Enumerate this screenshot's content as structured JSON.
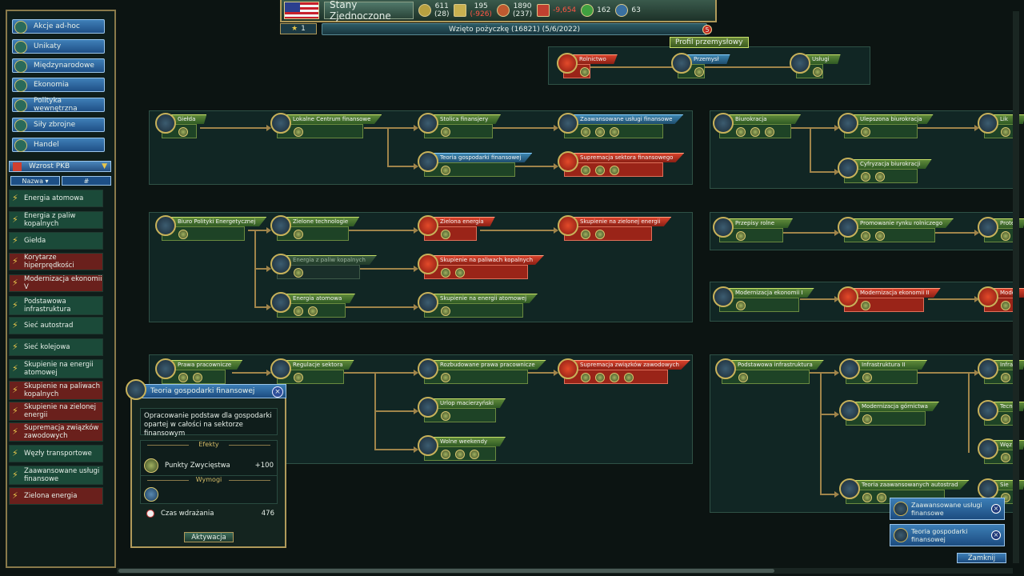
{
  "topbar": {
    "country": "Stany Zjednoczone",
    "res1": {
      "top": "611",
      "bottom": "(28)"
    },
    "res2": {
      "top": "195",
      "bottom": "(-926)"
    },
    "res3": {
      "top": "1890",
      "bottom": "(237)"
    },
    "res4": "-9,654",
    "res5": "162",
    "res6": "63",
    "turn": "1",
    "news": "Wzięto pożyczkę (16821) (5/6/2022)",
    "news_count": "5"
  },
  "sidebar": {
    "categories": [
      "Akcje ad-hoc",
      "Unikaty",
      "Międzynarodowe",
      "Ekonomia",
      "Polityka wewnętrzna",
      "Siły zbrojne",
      "Handel"
    ],
    "dropdown": "Wzrost PKB",
    "sort_name": "Nazwa",
    "sort_num": "#",
    "items": [
      {
        "label": "Energia atomowa",
        "color": "green"
      },
      {
        "label": "Energia z paliw kopalnych",
        "color": "green"
      },
      {
        "label": "Giełda",
        "color": "green"
      },
      {
        "label": "Korytarze hiperprędkości",
        "color": "red"
      },
      {
        "label": "Modernizacja ekonomii V",
        "color": "red"
      },
      {
        "label": "Podstawowa infrastruktura",
        "color": "green"
      },
      {
        "label": "Sieć autostrad",
        "color": "green"
      },
      {
        "label": "Sieć kolejowa",
        "color": "green"
      },
      {
        "label": "Skupienie na energii atomowej",
        "color": "green"
      },
      {
        "label": "Skupienie na paliwach kopalnych",
        "color": "red"
      },
      {
        "label": "Skupienie na zielonej energii",
        "color": "red"
      },
      {
        "label": "Supremacja związków zawodowych",
        "color": "red"
      },
      {
        "label": "Węzły transportowe",
        "color": "green"
      },
      {
        "label": "Zaawansowane usługi finansowe",
        "color": "green"
      },
      {
        "label": "Zielona energia",
        "color": "red"
      }
    ]
  },
  "profile": {
    "label": "Profil przemysłowy",
    "n1": "Rolnictwo",
    "n2": "Przemysł",
    "n3": "Usługi"
  },
  "tree": {
    "fin1": "Giełda",
    "fin2": "Lokalne Centrum finansowe",
    "fin3": "Stolica finansjery",
    "fin4": "Zaawansowane usługi finansowe",
    "fin5": "Teoria gospodarki finansowej",
    "fin6": "Supremacja sektora finansowego",
    "en1": "Biuro Polityki Energetycznej",
    "en2": "Zielone technologie",
    "en3": "Zielona energia",
    "en4": "Skupienie na zielonej energii",
    "en5": "Energia z paliw kopalnych",
    "en6": "Skupienie na paliwach kopalnych",
    "en7": "Energia atomowa",
    "en8": "Skupienie na energii atomowej",
    "lab1": "Prawa pracownicze",
    "lab2": "Regulacje sektora",
    "lab3": "Rozbudowane prawa pracownicze",
    "lab4": "Supremacja związków zawodowych",
    "lab5": "Urlop macierzyński",
    "lab6": "Wolne weekendy",
    "bur1": "Biurokracja",
    "bur2": "Ulepszona biurokracja",
    "bur3": "Cyfryzacja biurokracji",
    "bur4": "Lik",
    "agr1": "Przepisy rolne",
    "agr2": "Promowanie rynku rolniczego",
    "agr3": "Prote",
    "mod1": "Modernizacja ekonomii I",
    "mod2": "Modernizacja ekonomii II",
    "mod3": "Mode",
    "inf1": "Podstawowa infrastruktura",
    "inf2": "Infrastruktura II",
    "inf3": "Modernizacja górnictwa",
    "inf4": "Teoria zaawansowanych autostrad",
    "inf5": "Infra",
    "inf6": "Tecn",
    "inf7": "Węz",
    "inf8": "Sie"
  },
  "popup": {
    "title": "Teoria gospodarki finansowej",
    "description": "Opracowanie podstaw dla gospodarki opartej w całości na sektorze finansowym",
    "effects_header": "Efekty",
    "effect_label": "Punkty Zwycięstwa",
    "effect_value": "+100",
    "requirements_header": "Wymogi",
    "time_label": "Czas wdrażania",
    "time_value": "476",
    "activate": "Aktywacja",
    "close": "×"
  },
  "notifications": [
    "Zaawansowane usługi finansowe",
    "Teoria gospodarki finansowej"
  ],
  "close_label": "Zamknij",
  "colors": {
    "accent": "#b09a5a",
    "panel": "#112624",
    "red": "#d8422c",
    "green": "#5f8a3a",
    "blue": "#3c86b0"
  }
}
